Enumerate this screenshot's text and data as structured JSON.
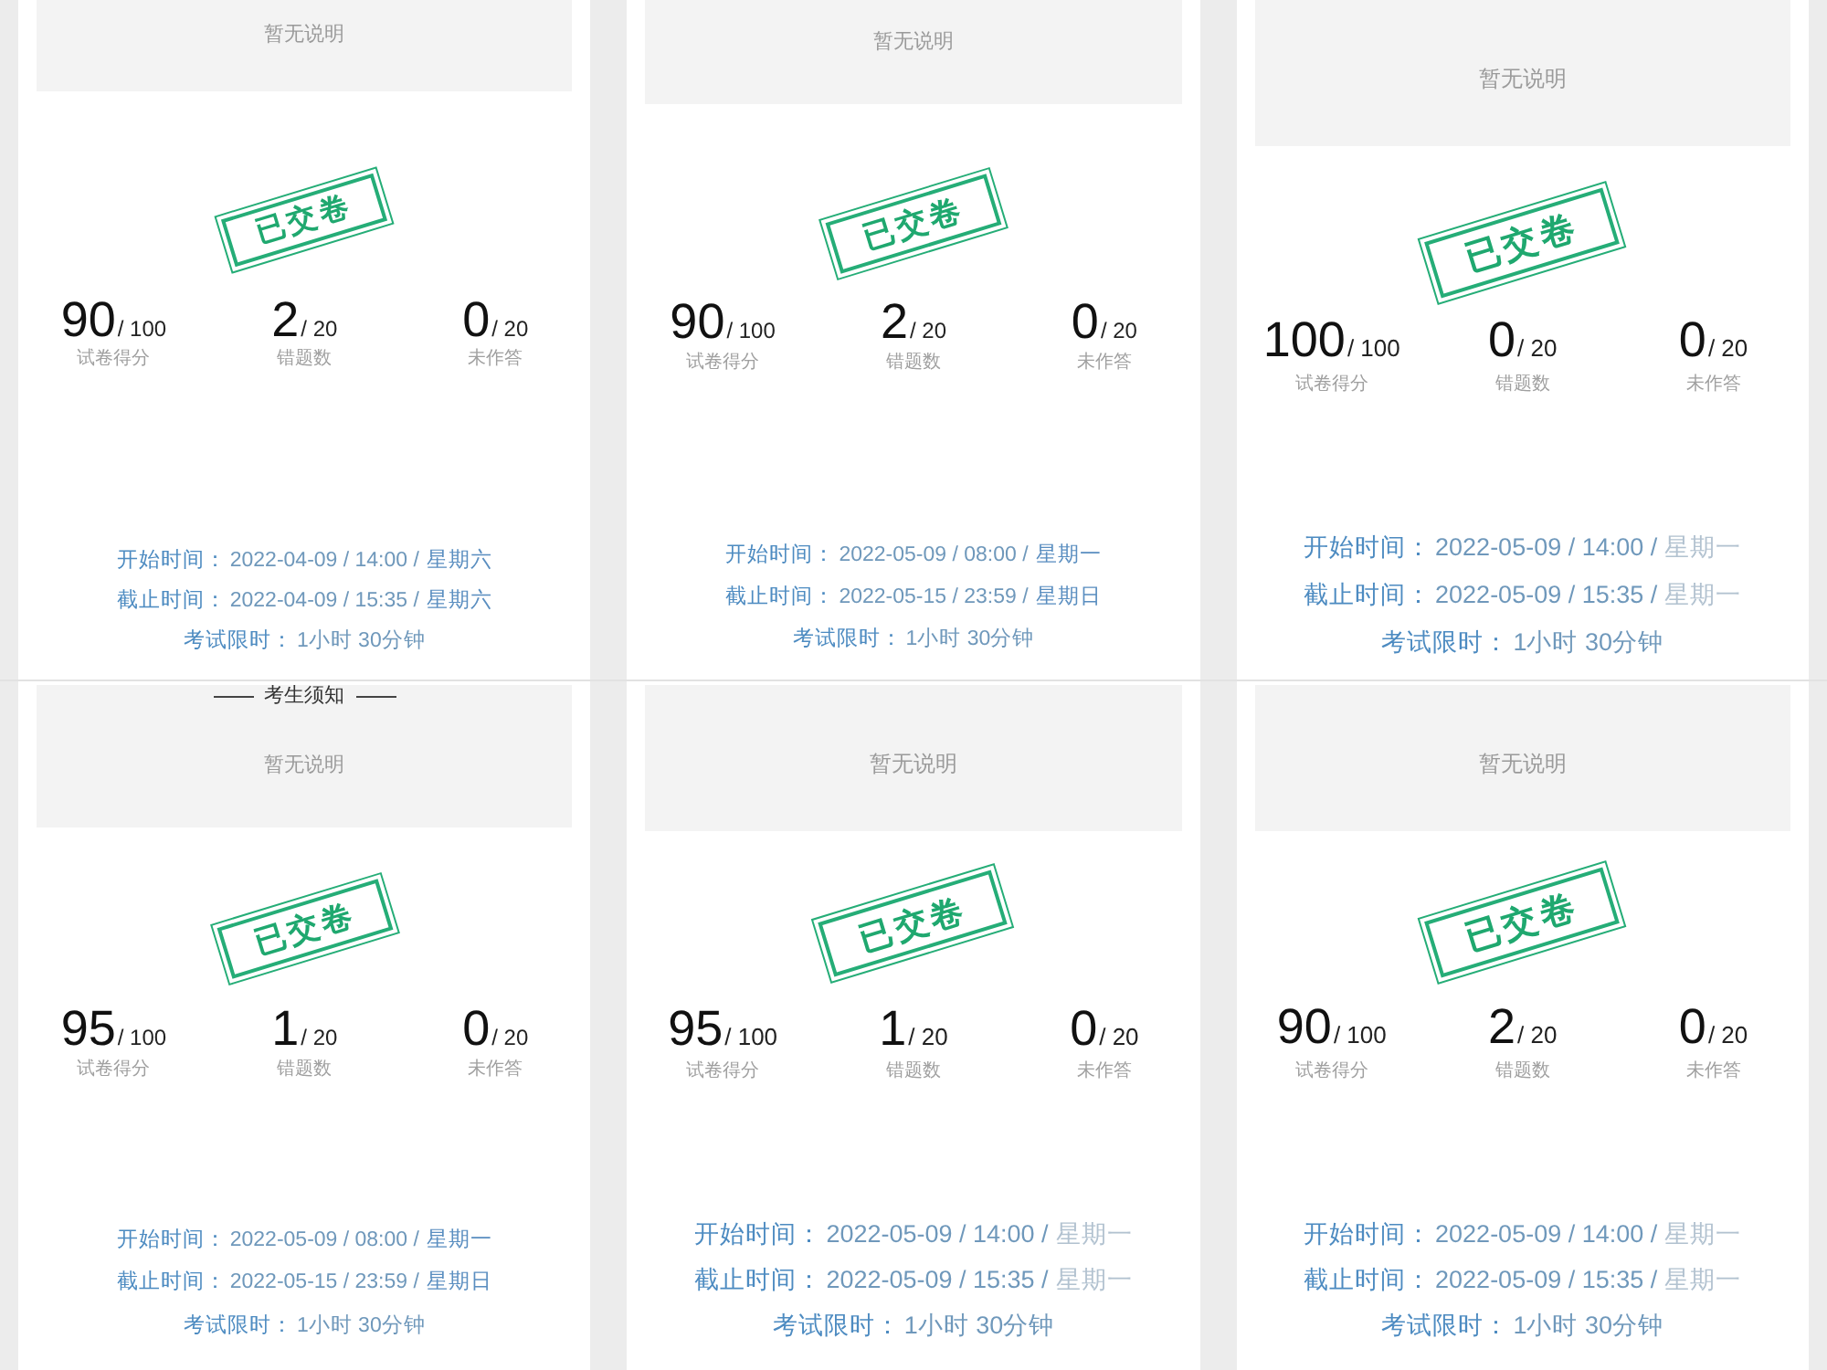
{
  "panels": [
    {
      "notice": {
        "text": "暂无说明"
      },
      "stamp": "已交卷",
      "stats": [
        {
          "value": "90",
          "total": "/ 100",
          "label": "试卷得分"
        },
        {
          "value": "2",
          "total": "/ 20",
          "label": "错题数"
        },
        {
          "value": "0",
          "total": "/ 20",
          "label": "未作答"
        }
      ],
      "times": [
        {
          "label": "开始时间：",
          "value": "2022-04-09 / 14:00 /",
          "weekday": {
            "text": "星期六",
            "faded": false
          }
        },
        {
          "label": "截止时间：",
          "value": "2022-04-09 / 15:35 /",
          "weekday": {
            "text": "星期六",
            "faded": false
          }
        },
        {
          "label": "考试限时：",
          "value": "1小时 30分钟"
        }
      ]
    },
    {
      "notice": {
        "text": "暂无说明"
      },
      "stamp": "已交卷",
      "stats": [
        {
          "value": "90",
          "total": "/ 100",
          "label": "试卷得分"
        },
        {
          "value": "2",
          "total": "/ 20",
          "label": "错题数"
        },
        {
          "value": "0",
          "total": "/ 20",
          "label": "未作答"
        }
      ],
      "times": [
        {
          "label": "开始时间：",
          "value": "2022-05-09 / 08:00 /",
          "weekday": {
            "text": "星期一",
            "faded": false
          }
        },
        {
          "label": "截止时间：",
          "value": "2022-05-15 / 23:59 /",
          "weekday": {
            "text": "星期日",
            "faded": false
          }
        },
        {
          "label": "考试限时：",
          "value": "1小时 30分钟"
        }
      ]
    },
    {
      "notice": {
        "text": "暂无说明"
      },
      "stamp": "已交卷",
      "stats": [
        {
          "value": "100",
          "total": "/ 100",
          "label": "试卷得分"
        },
        {
          "value": "0",
          "total": "/ 20",
          "label": "错题数"
        },
        {
          "value": "0",
          "total": "/ 20",
          "label": "未作答"
        }
      ],
      "times": [
        {
          "label": "开始时间：",
          "value": "2022-05-09 / 14:00 /",
          "weekday": {
            "text": "星期一",
            "faded": true
          }
        },
        {
          "label": "截止时间：",
          "value": "2022-05-09 / 15:35 /",
          "weekday": {
            "text": "星期一",
            "faded": true
          }
        },
        {
          "label": "考试限时：",
          "value": "1小时 30分钟"
        }
      ]
    },
    {
      "notice": {
        "heading": "考生须知",
        "text": "暂无说明"
      },
      "stamp": "已交卷",
      "stats": [
        {
          "value": "95",
          "total": "/ 100",
          "label": "试卷得分"
        },
        {
          "value": "1",
          "total": "/ 20",
          "label": "错题数"
        },
        {
          "value": "0",
          "total": "/ 20",
          "label": "未作答"
        }
      ],
      "times": [
        {
          "label": "开始时间：",
          "value": "2022-05-09 / 08:00 /",
          "weekday": {
            "text": "星期一",
            "faded": false
          }
        },
        {
          "label": "截止时间：",
          "value": "2022-05-15 / 23:59 /",
          "weekday": {
            "text": "星期日",
            "faded": false
          }
        },
        {
          "label": "考试限时：",
          "value": "1小时 30分钟"
        }
      ]
    },
    {
      "notice": {
        "text": "暂无说明"
      },
      "stamp": "已交卷",
      "stats": [
        {
          "value": "95",
          "total": "/ 100",
          "label": "试卷得分"
        },
        {
          "value": "1",
          "total": "/ 20",
          "label": "错题数"
        },
        {
          "value": "0",
          "total": "/ 20",
          "label": "未作答"
        }
      ],
      "times": [
        {
          "label": "开始时间：",
          "value": "2022-05-09 / 14:00 /",
          "weekday": {
            "text": "星期一",
            "faded": true
          }
        },
        {
          "label": "截止时间：",
          "value": "2022-05-09 / 15:35 /",
          "weekday": {
            "text": "星期一",
            "faded": true
          }
        },
        {
          "label": "考试限时：",
          "value": "1小时 30分钟"
        }
      ]
    },
    {
      "notice": {
        "text": "暂无说明"
      },
      "stamp": "已交卷",
      "stats": [
        {
          "value": "90",
          "total": "/ 100",
          "label": "试卷得分"
        },
        {
          "value": "2",
          "total": "/ 20",
          "label": "错题数"
        },
        {
          "value": "0",
          "total": "/ 20",
          "label": "未作答"
        }
      ],
      "times": [
        {
          "label": "开始时间：",
          "value": "2022-05-09 / 14:00 /",
          "weekday": {
            "text": "星期一",
            "faded": true
          }
        },
        {
          "label": "截止时间：",
          "value": "2022-05-09 / 15:35 /",
          "weekday": {
            "text": "星期一",
            "faded": true
          }
        },
        {
          "label": "考试限时：",
          "value": "1小时 30分钟"
        }
      ]
    }
  ]
}
